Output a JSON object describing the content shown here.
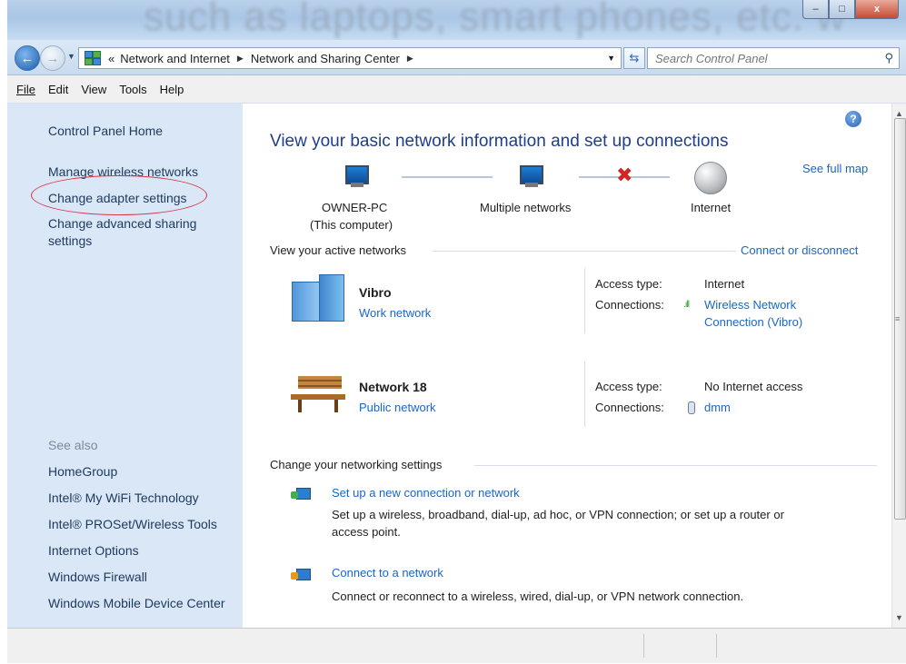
{
  "window": {
    "background_text": "such as laptops, smart phones, etc. w",
    "controls": {
      "minimize": "–",
      "maximize": "□",
      "close": "x"
    }
  },
  "nav": {
    "breadcrumb_overflow": "«",
    "crumbs": [
      "Network and Internet",
      "Network and Sharing Center"
    ],
    "search_placeholder": "Search Control Panel"
  },
  "menu": [
    "File",
    "Edit",
    "View",
    "Tools",
    "Help"
  ],
  "sidebar": {
    "home": "Control Panel Home",
    "tasks": [
      "Manage wireless networks",
      "Change adapter settings",
      "Change advanced sharing",
      "settings"
    ],
    "see_also_label": "See also",
    "see_also": [
      "HomeGroup",
      "Intel® My WiFi Technology",
      "Intel® PROSet/Wireless Tools",
      "Internet Options",
      "Windows Firewall",
      "Windows Mobile Device Center"
    ]
  },
  "main": {
    "heading": "View your basic network information and set up connections",
    "see_full_map": "See full map",
    "map": {
      "computer": "OWNER-PC",
      "computer_sub": "(This computer)",
      "middle": "Multiple networks",
      "internet": "Internet"
    },
    "active_title": "View your active networks",
    "connect_disconnect": "Connect or disconnect",
    "networks": [
      {
        "name": "Vibro",
        "type": "Work network",
        "access_label": "Access type:",
        "access": "Internet",
        "conn_label": "Connections:",
        "conn_line1": "Wireless Network",
        "conn_line2": "Connection (Vibro)"
      },
      {
        "name": "Network  18",
        "type": "Public network",
        "access_label": "Access type:",
        "access": "No Internet access",
        "conn_label": "Connections:",
        "conn_line1": "dmm"
      }
    ],
    "change_title": "Change your networking settings",
    "tasks": [
      {
        "title": "Set up a new connection or network",
        "desc1": "Set up a wireless, broadband, dial-up, ad hoc, or VPN connection; or set up a router or",
        "desc2": "access point."
      },
      {
        "title": "Connect to a network",
        "desc1": "Connect or reconnect to a wireless, wired, dial-up, or VPN network connection."
      }
    ]
  }
}
